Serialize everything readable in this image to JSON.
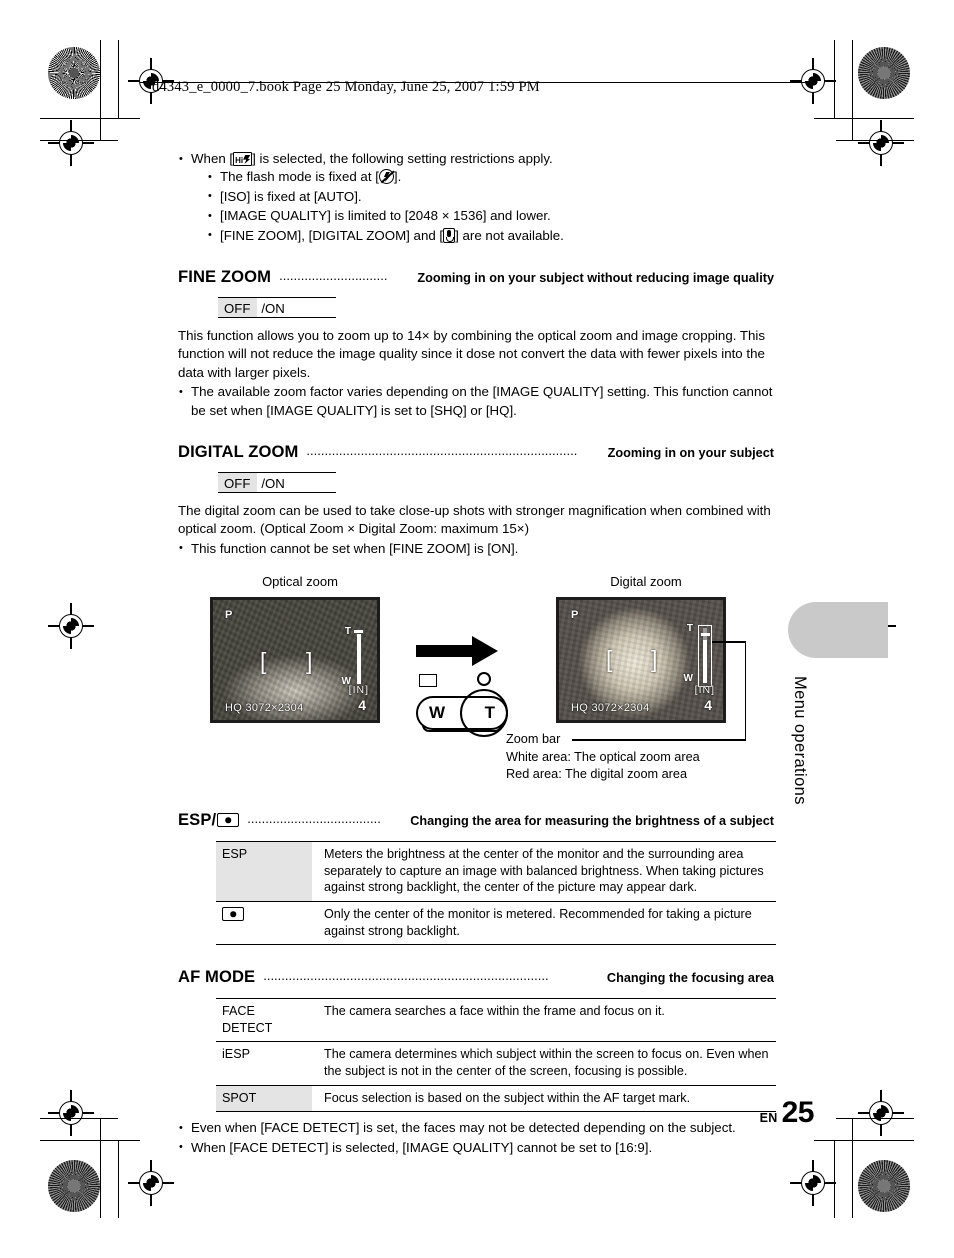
{
  "header": {
    "text": "d4343_e_0000_7.book  Page 25  Monday, June 25, 2007  1:59 PM"
  },
  "intro_bullets": {
    "lead_before": "When [",
    "lead_icon": "sequential-hi-icon",
    "lead_after": "] is selected, the following setting restrictions apply.",
    "sub": [
      {
        "before": "The flash mode is fixed at [",
        "icon": "flash-off-icon",
        "after": "]."
      },
      {
        "before": "[ISO] is fixed at [AUTO].",
        "icon": "",
        "after": ""
      },
      {
        "before": "[IMAGE QUALITY] is limited to [2048 × 1536] and lower.",
        "icon": "",
        "after": ""
      },
      {
        "before": "[FINE ZOOM], [DIGITAL ZOOM] and [",
        "icon": "microphone-icon",
        "after": "] are not available."
      }
    ]
  },
  "fine_zoom": {
    "title": "FINE ZOOM",
    "dots": "..............................",
    "desc": "Zooming in on your subject without reducing image quality",
    "option_selected": "OFF",
    "option_rest": "/ON",
    "body": "This function allows you to zoom up to 14× by combining the optical zoom and image cropping. This function will not reduce the image quality since it dose not convert the data with fewer pixels into the data with larger pixels.",
    "note": "The available zoom factor varies depending on the [IMAGE QUALITY] setting. This function cannot be set when [IMAGE QUALITY] is set to [SHQ] or [HQ]."
  },
  "digital_zoom": {
    "title": "DIGITAL ZOOM",
    "dots": "...........................................................................",
    "desc": "Zooming in on your subject",
    "option_selected": "OFF",
    "option_rest": "/ON",
    "body": "The digital zoom can be used to take close-up shots with stronger magnification when combined with optical zoom. (Optical Zoom × Digital Zoom: maximum 15×)",
    "note": "This function cannot be set when [FINE ZOOM] is [ON]."
  },
  "figures": {
    "optical_caption": "Optical zoom",
    "digital_caption": "Digital zoom",
    "lcd_optical": {
      "mode": "P",
      "in_indicator": "[IN]",
      "frame_count": "4",
      "quality": "HQ 3072×2304",
      "zoom_T": "T",
      "zoom_W": "W"
    },
    "lcd_digital": {
      "mode": "P",
      "in_indicator": "[IN]",
      "frame_count": "4",
      "quality": "HQ 3072×2304",
      "zoom_T": "T",
      "zoom_W": "W"
    },
    "rocker": {
      "wide_label": "W",
      "tele_label": "T",
      "index_icon": "index-thumbnail-icon",
      "magnify_icon": "magnifier-icon"
    },
    "callout": {
      "line1": "Zoom bar",
      "line2": "White area: The optical zoom area",
      "line3": "Red area: The digital zoom area"
    }
  },
  "esp": {
    "title_prefix": "ESP/",
    "title_icon": "spot-metering-icon",
    "dots": ".....................................",
    "desc": "Changing the area for measuring the brightness of a subject",
    "rows": [
      {
        "label": "ESP",
        "label_icon": "",
        "highlighted": true,
        "value": "Meters the brightness at the center of the monitor and the surrounding area separately to capture an image with balanced brightness. When taking pictures against strong backlight, the center of the picture may appear dark."
      },
      {
        "label": "",
        "label_icon": "spot-metering-icon",
        "highlighted": false,
        "value": "Only the center of the monitor is metered. Recommended for taking a picture against strong backlight."
      }
    ]
  },
  "af_mode": {
    "title": "AF MODE",
    "dots": "...............................................................................",
    "desc": "Changing the focusing area",
    "rows": [
      {
        "label": "FACE\nDETECT",
        "highlighted": false,
        "value": "The camera searches a face within the frame and focus on it."
      },
      {
        "label": "iESP",
        "highlighted": false,
        "value": "The camera determines which subject within the screen to focus on. Even when the subject is not in the center of the screen, focusing is possible."
      },
      {
        "label": "SPOT",
        "highlighted": true,
        "value": "Focus selection is based on the subject within the AF target mark."
      }
    ],
    "notes": [
      "Even when [FACE DETECT] is set, the faces may not be detected depending on the subject.",
      "When [FACE DETECT] is selected,  [IMAGE QUALITY] cannot be set to [16:9]."
    ]
  },
  "side_tab": {
    "label": "Menu operations"
  },
  "page_number": {
    "lang": "EN",
    "number": "25"
  },
  "colors": {
    "highlight_gray": "#e4e4e4",
    "tab_gray": "#c9c9c9",
    "text": "#000000"
  }
}
